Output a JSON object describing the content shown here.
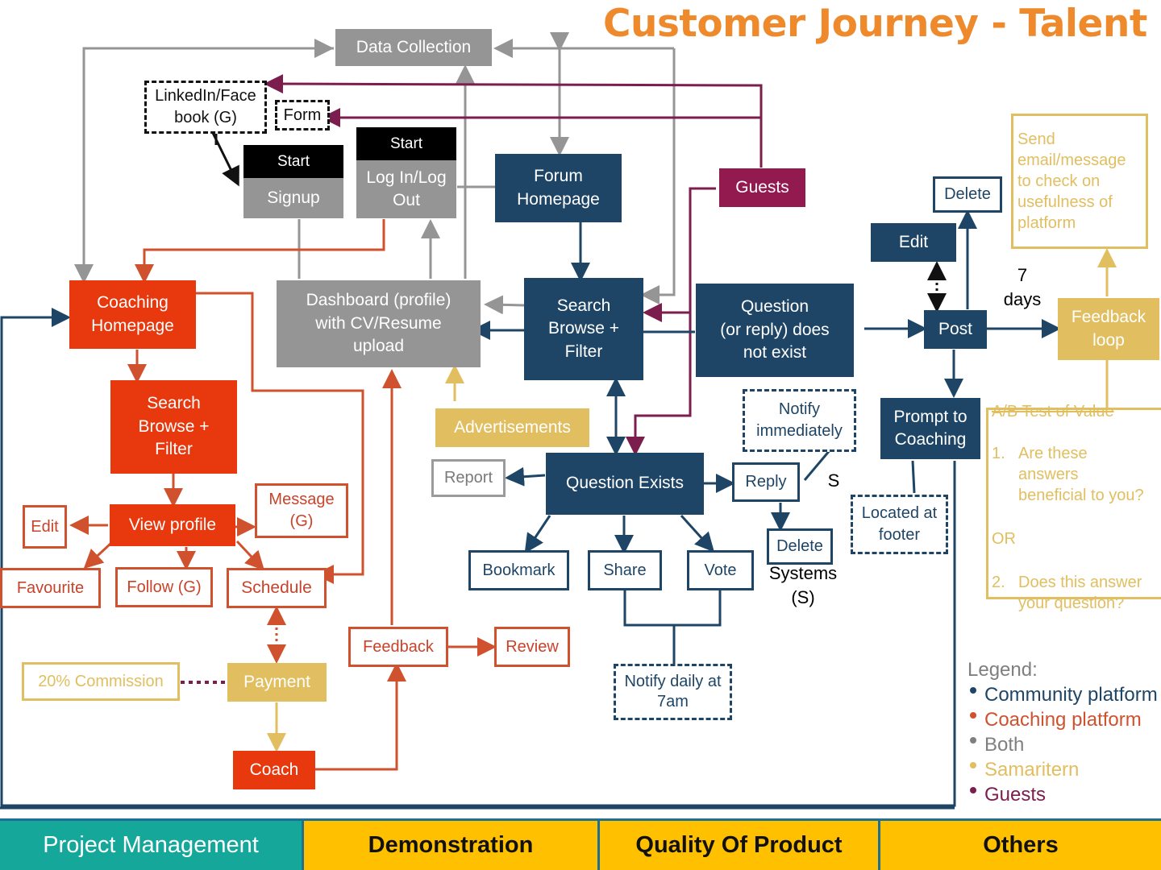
{
  "title": "Customer Journey - Talent Po",
  "nodes": {
    "data_collection": "Data Collection",
    "linkedin": "LinkedIn/Face\nbook (G)",
    "form": "Form",
    "start_signup": "Start",
    "signup": "Signup",
    "start_login": "Start",
    "login": "Log In/Log\nOut",
    "forum_homepage": "Forum\nHomepage",
    "guests": "Guests",
    "delete_top": "Delete",
    "edit_top": "Edit",
    "send_email": "Send\nemail/message\nto check on\nusefulness of\nplatform",
    "seven_days": "7\ndays",
    "coaching_homepage": "Coaching\nHomepage",
    "dashboard": "Dashboard (profile)\nwith CV/Resume\nupload",
    "search_forum": "Search\nBrowse +\nFilter",
    "question_not_exist": "Question\n(or reply) does\nnot exist",
    "post": "Post",
    "feedback_loop": "Feedback\nloop",
    "search_coaching": "Search\nBrowse +\nFilter",
    "advertisements": "Advertisements",
    "notify_immediately": "Notify\nimmediately",
    "prompt_coaching": "Prompt to\nCoaching",
    "report": "Report",
    "question_exists": "Question Exists",
    "reply": "Reply",
    "s_label": "S",
    "located_footer": "Located at\nfooter",
    "edit_coaching": "Edit",
    "view_profile": "View profile",
    "message": "Message\n(G)",
    "delete_reply": "Delete",
    "systems": "Systems\n(S)",
    "favourite": "Favourite",
    "follow": "Follow (G)",
    "schedule": "Schedule",
    "bookmark": "Bookmark",
    "share": "Share",
    "vote": "Vote",
    "feedback": "Feedback",
    "review": "Review",
    "commission": "20% Commission",
    "payment": "Payment",
    "notify_daily": "Notify daily at\n7am",
    "coach": "Coach"
  },
  "ab_test": {
    "title": "A/B Test of Value",
    "q1_num": "1.",
    "q1": "Are these\nanswers\nbeneficial to you?",
    "or": "OR",
    "q2_num": "2.",
    "q2": "Does this answer\nyour question?"
  },
  "legend": {
    "title": "Legend:",
    "items": [
      {
        "label": "Community platform",
        "color": "#1E4566"
      },
      {
        "label": "Coaching platform",
        "color": "#D0512E"
      },
      {
        "label": "Both",
        "color": "#7f7f7f"
      },
      {
        "label": "Samaritern",
        "color": "#E1BE5F"
      },
      {
        "label": "Guests",
        "color": "#7B1E4E"
      }
    ]
  },
  "tabs": [
    {
      "label": "Project Management"
    },
    {
      "label": "Demonstration"
    },
    {
      "label": "Quality Of Product"
    },
    {
      "label": "Others"
    }
  ]
}
